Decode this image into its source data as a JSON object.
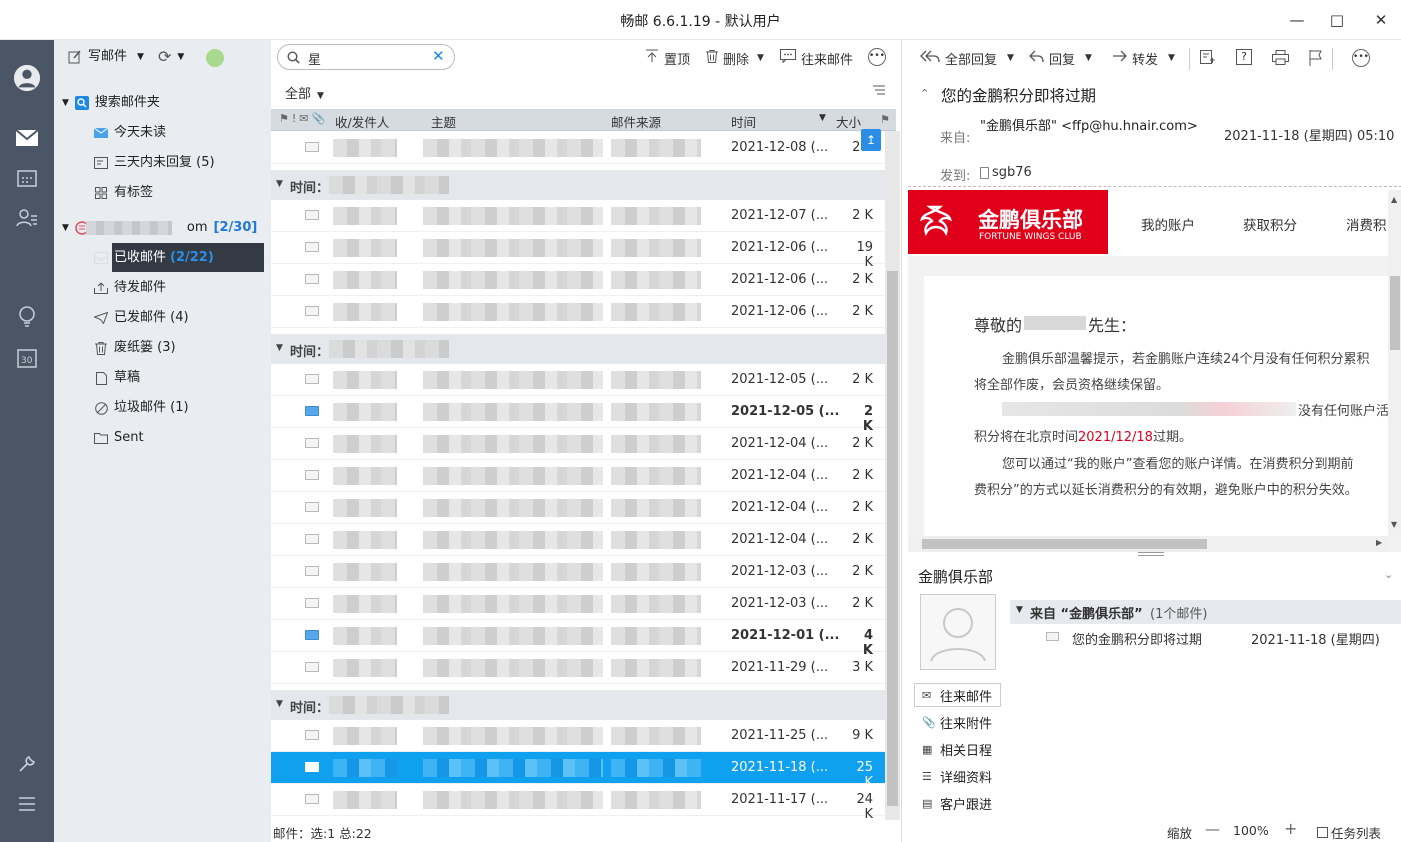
{
  "window": {
    "title": "畅邮 6.6.1.19 - 默认用户"
  },
  "folders": {
    "compose_label": "写邮件",
    "search_folder": "搜索邮件夹",
    "search_items": [
      {
        "label": "今天未读"
      },
      {
        "label": "三天内未回复 (5)"
      },
      {
        "label": "有标签"
      }
    ],
    "account_suffix": "om",
    "account_count": "[2/30]",
    "mail_items": [
      {
        "label": "已收邮件",
        "count": "(2/22)"
      },
      {
        "label": "待发邮件",
        "count": ""
      },
      {
        "label": "已发邮件 (4)",
        "count": ""
      },
      {
        "label": "废纸篓 (3)",
        "count": ""
      },
      {
        "label": "草稿",
        "count": ""
      },
      {
        "label": "垃圾邮件 (1)",
        "count": ""
      },
      {
        "label": "Sent",
        "count": ""
      }
    ]
  },
  "list": {
    "search_value": "星",
    "filter_label": "全部",
    "toolbar": {
      "pin": "置顶",
      "delete": "删除",
      "history": "往来邮件"
    },
    "columns": {
      "from": "收/发件人",
      "subject": "主题",
      "source": "邮件来源",
      "time": "时间",
      "size": "大小"
    },
    "group_label": "时间：",
    "rows": [
      {
        "date": "2021-12-08 (...",
        "size": "2 K",
        "read": true,
        "bold": false
      },
      {
        "date": "2021-12-07 (...",
        "size": "2 K",
        "read": true,
        "bold": false
      },
      {
        "date": "2021-12-06 (...",
        "size": "19 K",
        "read": true,
        "bold": false
      },
      {
        "date": "2021-12-06 (...",
        "size": "2 K",
        "read": true,
        "bold": false
      },
      {
        "date": "2021-12-06 (...",
        "size": "2 K",
        "read": true,
        "bold": false
      },
      {
        "date": "2021-12-05 (...",
        "size": "2 K",
        "read": true,
        "bold": false
      },
      {
        "date": "2021-12-05 (...",
        "size": "2 K",
        "read": false,
        "bold": true
      },
      {
        "date": "2021-12-04 (...",
        "size": "2 K",
        "read": true,
        "bold": false
      },
      {
        "date": "2021-12-04 (...",
        "size": "2 K",
        "read": true,
        "bold": false
      },
      {
        "date": "2021-12-04 (...",
        "size": "2 K",
        "read": true,
        "bold": false
      },
      {
        "date": "2021-12-04 (...",
        "size": "2 K",
        "read": true,
        "bold": false
      },
      {
        "date": "2021-12-03 (...",
        "size": "2 K",
        "read": true,
        "bold": false
      },
      {
        "date": "2021-12-03 (...",
        "size": "2 K",
        "read": true,
        "bold": false
      },
      {
        "date": "2021-12-01 (...",
        "size": "4 K",
        "read": false,
        "bold": true
      },
      {
        "date": "2021-11-29 (...",
        "size": "3 K",
        "read": true,
        "bold": false
      },
      {
        "date": "2021-11-25 (...",
        "size": "9 K",
        "read": true,
        "bold": false
      },
      {
        "date": "2021-11-18 (...",
        "size": "25 K",
        "read": true,
        "bold": false,
        "selected": true
      },
      {
        "date": "2021-11-17 (...",
        "size": "24 K",
        "read": true,
        "bold": false
      }
    ],
    "status": "邮件：选:1 总:22"
  },
  "reader": {
    "toolbar": {
      "reply_all": "全部回复",
      "reply": "回复",
      "forward": "转发"
    },
    "subject": "您的金鹏积分即将过期",
    "from_label": "来自:",
    "from_value": "\"金鹏俱乐部\" <ffp@hu.hnair.com>",
    "date": "2021-11-18 (星期四) 05:10",
    "to_label": "发到:",
    "to_value": "sgb76",
    "email": {
      "brand_cn": "金鹏俱乐部",
      "brand_en": "FORTUNE WINGS CLUB",
      "nav": [
        "我的账户",
        "获取积分",
        "消费积"
      ],
      "greeting": "尊敬的",
      "greeting_suffix": "先生：",
      "p1": "金鹏俱乐部温馨提示，若金鹏账户连续24个月没有任何积分累积",
      "p1b": "将全部作废，会员资格继续保留。",
      "p2": "没有任何账户活",
      "p3a": "积分将在北京时间",
      "p3date": "2021/12/18",
      "p3b": "过期。",
      "p4": "您可以通过“我的账户”查看您的账户详情。在消费积分到期前",
      "p4b": "费积分”的方式以延长消费积分的有效期，避免账户中的积分失效。"
    },
    "contact": {
      "name": "金鹏俱乐部",
      "group_label": "来自 “金鹏俱乐部”",
      "group_count": "(1个邮件)",
      "item_subject": "您的金鹏积分即将过期",
      "item_date": "2021-11-18 (星期四)",
      "actions": [
        "往来邮件",
        "往来附件",
        "相关日程",
        "详细资料",
        "客户跟进"
      ]
    },
    "status": {
      "zoom_label": "缩放",
      "zoom_value": "100%",
      "tasklist": "任务列表"
    }
  },
  "colors": {
    "rail": "#4a5566",
    "accent": "#0e8ee9",
    "brand_red": "#e1001a",
    "selected_row": "#10a0f0"
  }
}
